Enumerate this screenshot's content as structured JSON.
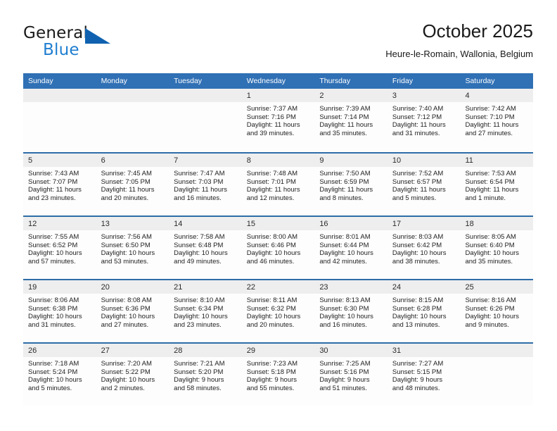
{
  "brand": {
    "name_top": "General",
    "name_bottom": "Blue",
    "accent_color": "#1062b0",
    "text_color": "#1a1a1a",
    "blue_text_color": "#1f7ed0"
  },
  "header": {
    "title": "October 2025",
    "subtitle": "Heure-le-Romain, Wallonia, Belgium"
  },
  "theme": {
    "header_bar": "#3070b5",
    "row_divider": "#2e6da8",
    "date_strip": "#eeeeee",
    "cell_bg": "#fdfdfd"
  },
  "weekdays": [
    "Sunday",
    "Monday",
    "Tuesday",
    "Wednesday",
    "Thursday",
    "Friday",
    "Saturday"
  ],
  "weeks": [
    [
      {
        "day": "",
        "empty": true,
        "lines": []
      },
      {
        "day": "",
        "empty": true,
        "lines": []
      },
      {
        "day": "",
        "empty": true,
        "lines": []
      },
      {
        "day": "1",
        "empty": false,
        "lines": [
          "Sunrise: 7:37 AM",
          "Sunset: 7:16 PM",
          "Daylight: 11 hours",
          "and 39 minutes."
        ]
      },
      {
        "day": "2",
        "empty": false,
        "lines": [
          "Sunrise: 7:39 AM",
          "Sunset: 7:14 PM",
          "Daylight: 11 hours",
          "and 35 minutes."
        ]
      },
      {
        "day": "3",
        "empty": false,
        "lines": [
          "Sunrise: 7:40 AM",
          "Sunset: 7:12 PM",
          "Daylight: 11 hours",
          "and 31 minutes."
        ]
      },
      {
        "day": "4",
        "empty": false,
        "lines": [
          "Sunrise: 7:42 AM",
          "Sunset: 7:10 PM",
          "Daylight: 11 hours",
          "and 27 minutes."
        ]
      }
    ],
    [
      {
        "day": "5",
        "empty": false,
        "lines": [
          "Sunrise: 7:43 AM",
          "Sunset: 7:07 PM",
          "Daylight: 11 hours",
          "and 23 minutes."
        ]
      },
      {
        "day": "6",
        "empty": false,
        "lines": [
          "Sunrise: 7:45 AM",
          "Sunset: 7:05 PM",
          "Daylight: 11 hours",
          "and 20 minutes."
        ]
      },
      {
        "day": "7",
        "empty": false,
        "lines": [
          "Sunrise: 7:47 AM",
          "Sunset: 7:03 PM",
          "Daylight: 11 hours",
          "and 16 minutes."
        ]
      },
      {
        "day": "8",
        "empty": false,
        "lines": [
          "Sunrise: 7:48 AM",
          "Sunset: 7:01 PM",
          "Daylight: 11 hours",
          "and 12 minutes."
        ]
      },
      {
        "day": "9",
        "empty": false,
        "lines": [
          "Sunrise: 7:50 AM",
          "Sunset: 6:59 PM",
          "Daylight: 11 hours",
          "and 8 minutes."
        ]
      },
      {
        "day": "10",
        "empty": false,
        "lines": [
          "Sunrise: 7:52 AM",
          "Sunset: 6:57 PM",
          "Daylight: 11 hours",
          "and 5 minutes."
        ]
      },
      {
        "day": "11",
        "empty": false,
        "lines": [
          "Sunrise: 7:53 AM",
          "Sunset: 6:54 PM",
          "Daylight: 11 hours",
          "and 1 minute."
        ]
      }
    ],
    [
      {
        "day": "12",
        "empty": false,
        "lines": [
          "Sunrise: 7:55 AM",
          "Sunset: 6:52 PM",
          "Daylight: 10 hours",
          "and 57 minutes."
        ]
      },
      {
        "day": "13",
        "empty": false,
        "lines": [
          "Sunrise: 7:56 AM",
          "Sunset: 6:50 PM",
          "Daylight: 10 hours",
          "and 53 minutes."
        ]
      },
      {
        "day": "14",
        "empty": false,
        "lines": [
          "Sunrise: 7:58 AM",
          "Sunset: 6:48 PM",
          "Daylight: 10 hours",
          "and 49 minutes."
        ]
      },
      {
        "day": "15",
        "empty": false,
        "lines": [
          "Sunrise: 8:00 AM",
          "Sunset: 6:46 PM",
          "Daylight: 10 hours",
          "and 46 minutes."
        ]
      },
      {
        "day": "16",
        "empty": false,
        "lines": [
          "Sunrise: 8:01 AM",
          "Sunset: 6:44 PM",
          "Daylight: 10 hours",
          "and 42 minutes."
        ]
      },
      {
        "day": "17",
        "empty": false,
        "lines": [
          "Sunrise: 8:03 AM",
          "Sunset: 6:42 PM",
          "Daylight: 10 hours",
          "and 38 minutes."
        ]
      },
      {
        "day": "18",
        "empty": false,
        "lines": [
          "Sunrise: 8:05 AM",
          "Sunset: 6:40 PM",
          "Daylight: 10 hours",
          "and 35 minutes."
        ]
      }
    ],
    [
      {
        "day": "19",
        "empty": false,
        "lines": [
          "Sunrise: 8:06 AM",
          "Sunset: 6:38 PM",
          "Daylight: 10 hours",
          "and 31 minutes."
        ]
      },
      {
        "day": "20",
        "empty": false,
        "lines": [
          "Sunrise: 8:08 AM",
          "Sunset: 6:36 PM",
          "Daylight: 10 hours",
          "and 27 minutes."
        ]
      },
      {
        "day": "21",
        "empty": false,
        "lines": [
          "Sunrise: 8:10 AM",
          "Sunset: 6:34 PM",
          "Daylight: 10 hours",
          "and 23 minutes."
        ]
      },
      {
        "day": "22",
        "empty": false,
        "lines": [
          "Sunrise: 8:11 AM",
          "Sunset: 6:32 PM",
          "Daylight: 10 hours",
          "and 20 minutes."
        ]
      },
      {
        "day": "23",
        "empty": false,
        "lines": [
          "Sunrise: 8:13 AM",
          "Sunset: 6:30 PM",
          "Daylight: 10 hours",
          "and 16 minutes."
        ]
      },
      {
        "day": "24",
        "empty": false,
        "lines": [
          "Sunrise: 8:15 AM",
          "Sunset: 6:28 PM",
          "Daylight: 10 hours",
          "and 13 minutes."
        ]
      },
      {
        "day": "25",
        "empty": false,
        "lines": [
          "Sunrise: 8:16 AM",
          "Sunset: 6:26 PM",
          "Daylight: 10 hours",
          "and 9 minutes."
        ]
      }
    ],
    [
      {
        "day": "26",
        "empty": false,
        "lines": [
          "Sunrise: 7:18 AM",
          "Sunset: 5:24 PM",
          "Daylight: 10 hours",
          "and 5 minutes."
        ]
      },
      {
        "day": "27",
        "empty": false,
        "lines": [
          "Sunrise: 7:20 AM",
          "Sunset: 5:22 PM",
          "Daylight: 10 hours",
          "and 2 minutes."
        ]
      },
      {
        "day": "28",
        "empty": false,
        "lines": [
          "Sunrise: 7:21 AM",
          "Sunset: 5:20 PM",
          "Daylight: 9 hours",
          "and 58 minutes."
        ]
      },
      {
        "day": "29",
        "empty": false,
        "lines": [
          "Sunrise: 7:23 AM",
          "Sunset: 5:18 PM",
          "Daylight: 9 hours",
          "and 55 minutes."
        ]
      },
      {
        "day": "30",
        "empty": false,
        "lines": [
          "Sunrise: 7:25 AM",
          "Sunset: 5:16 PM",
          "Daylight: 9 hours",
          "and 51 minutes."
        ]
      },
      {
        "day": "31",
        "empty": false,
        "lines": [
          "Sunrise: 7:27 AM",
          "Sunset: 5:15 PM",
          "Daylight: 9 hours",
          "and 48 minutes."
        ]
      },
      {
        "day": "",
        "empty": true,
        "lines": []
      }
    ]
  ]
}
